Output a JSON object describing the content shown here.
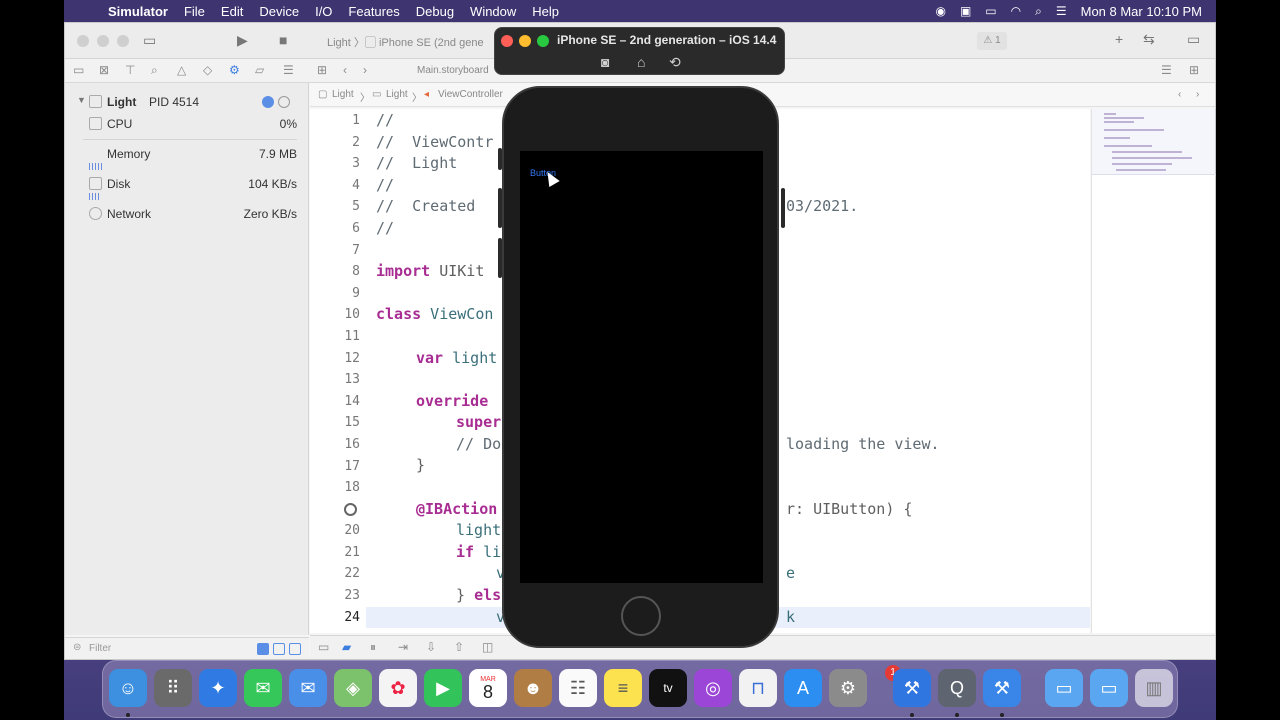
{
  "menubar": {
    "app": "Simulator",
    "items": [
      "File",
      "Edit",
      "Device",
      "I/O",
      "Features",
      "Debug",
      "Window",
      "Help"
    ],
    "clock": "Mon 8 Mar  10:10 PM"
  },
  "toolbar": {
    "scheme_app": "Light",
    "scheme_device": "iPhone SE (2nd gene",
    "warning_count": "1"
  },
  "navbar": {
    "tab": "Main.storyboard"
  },
  "debug_navigator": {
    "process": "Light",
    "pid": "PID 4514",
    "gauges": [
      {
        "label": "CPU",
        "value": "0%"
      },
      {
        "label": "Memory",
        "value": "7.9 MB"
      },
      {
        "label": "Disk",
        "value": "104 KB/s"
      },
      {
        "label": "Network",
        "value": "Zero KB/s"
      }
    ],
    "filter_placeholder": "Filter"
  },
  "jumpbar": {
    "crumbs": [
      "Light",
      "Light",
      "ViewController"
    ]
  },
  "editor": {
    "line_numbers": [
      "1",
      "2",
      "3",
      "4",
      "5",
      "6",
      "7",
      "8",
      "9",
      "10",
      "11",
      "12",
      "13",
      "14",
      "15",
      "16",
      "17",
      "18",
      "19",
      "20",
      "21",
      "22",
      "23",
      "24"
    ],
    "lines": {
      "l1": "//",
      "l2": "//  ViewContr",
      "l3": "//  Light",
      "l4": "//",
      "l5a": "//  Created ",
      "l5b": "03/2021.",
      "l6": "//",
      "l8a": "import",
      "l8b": " UIKit",
      "l10a": "class",
      "l10b": " ViewCon",
      "l12a": "var",
      "l12b": " light",
      "l14": "override",
      "l15": "super",
      "l16a": "// Do",
      "l16b": "loading the view.",
      "l17": "}",
      "l19a": "@IBAction",
      "l19b": "r: UIButton) {",
      "l20": "light",
      "l21a": "if",
      "l21b": " li",
      "l22a": "v",
      "l22b": "e",
      "l23a": "} ",
      "l23b": "els",
      "l24a": "v",
      "l24b": "k"
    }
  },
  "simulator": {
    "title": "iPhone SE – 2nd generation – iOS 14.4",
    "screen_button": "Button"
  },
  "dock": {
    "calendar_month": "MAR",
    "calendar_day": "8",
    "tv_label": "tv",
    "badge_count": "1"
  }
}
